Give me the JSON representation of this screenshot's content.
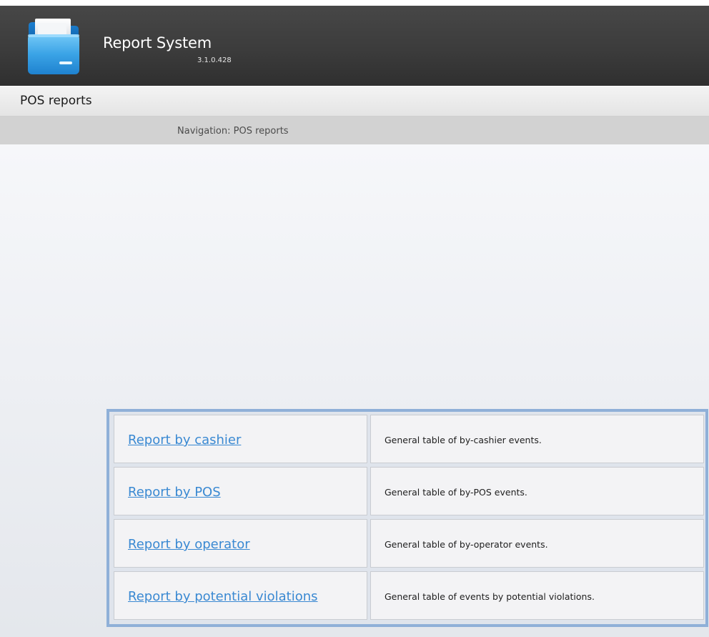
{
  "app": {
    "title": "Report System",
    "version": "3.1.0.428",
    "logo_icon": "folder-icon"
  },
  "page": {
    "title": "POS reports"
  },
  "navigation": {
    "text": "Navigation: POS reports"
  },
  "colors": {
    "header_bg": "#3c3c3c",
    "link": "#3a89d2",
    "table_border": "#8fb0d8"
  },
  "reports": [
    {
      "label": "Report by cashier",
      "description": "General table of by-cashier events."
    },
    {
      "label": "Report by POS",
      "description": "General table of by-POS events."
    },
    {
      "label": "Report by operator",
      "description": "General table of by-operator events."
    },
    {
      "label": "Report by potential violations",
      "description": "General table of events by potential violations."
    }
  ]
}
